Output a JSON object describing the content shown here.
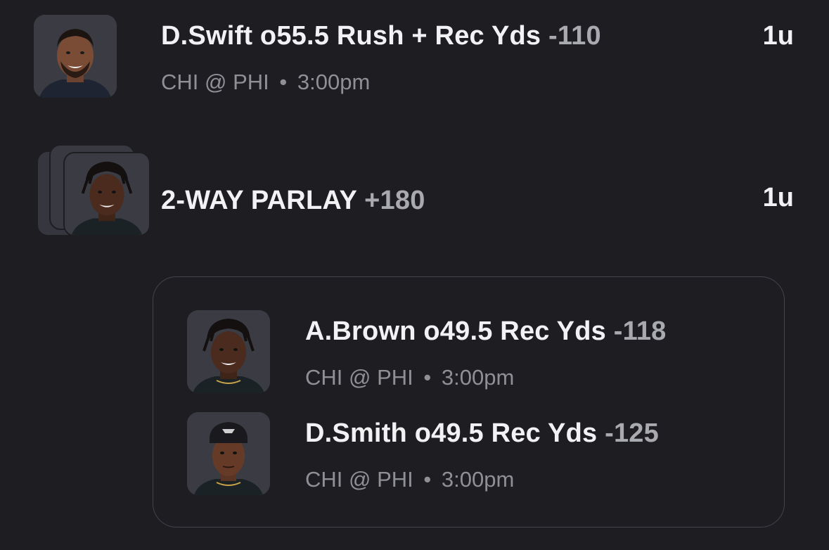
{
  "bets": [
    {
      "title": "D.Swift o55.5 Rush + Rec Yds",
      "odds": "-110",
      "matchup": "CHI @ PHI",
      "separator": "•",
      "time": "3:00pm",
      "units": "1u",
      "avatar": "player-headshot"
    }
  ],
  "parlay": {
    "title": "2-WAY PARLAY",
    "odds": "+180",
    "units": "1u",
    "avatar": "stacked-player-headshots",
    "legs": [
      {
        "title": "A.Brown o49.5 Rec Yds",
        "odds": "-118",
        "matchup": "CHI @ PHI",
        "separator": "•",
        "time": "3:00pm",
        "avatar": "player-headshot"
      },
      {
        "title": "D.Smith o49.5 Rec Yds",
        "odds": "-125",
        "matchup": "CHI @ PHI",
        "separator": "•",
        "time": "3:00pm",
        "avatar": "player-headshot"
      }
    ]
  },
  "colors": {
    "background": "#1d1d22",
    "text_primary": "#f2f2f4",
    "text_odds": "#a9a9b0",
    "text_secondary": "#8f8f96",
    "avatar_bg": "#3a3b42"
  }
}
